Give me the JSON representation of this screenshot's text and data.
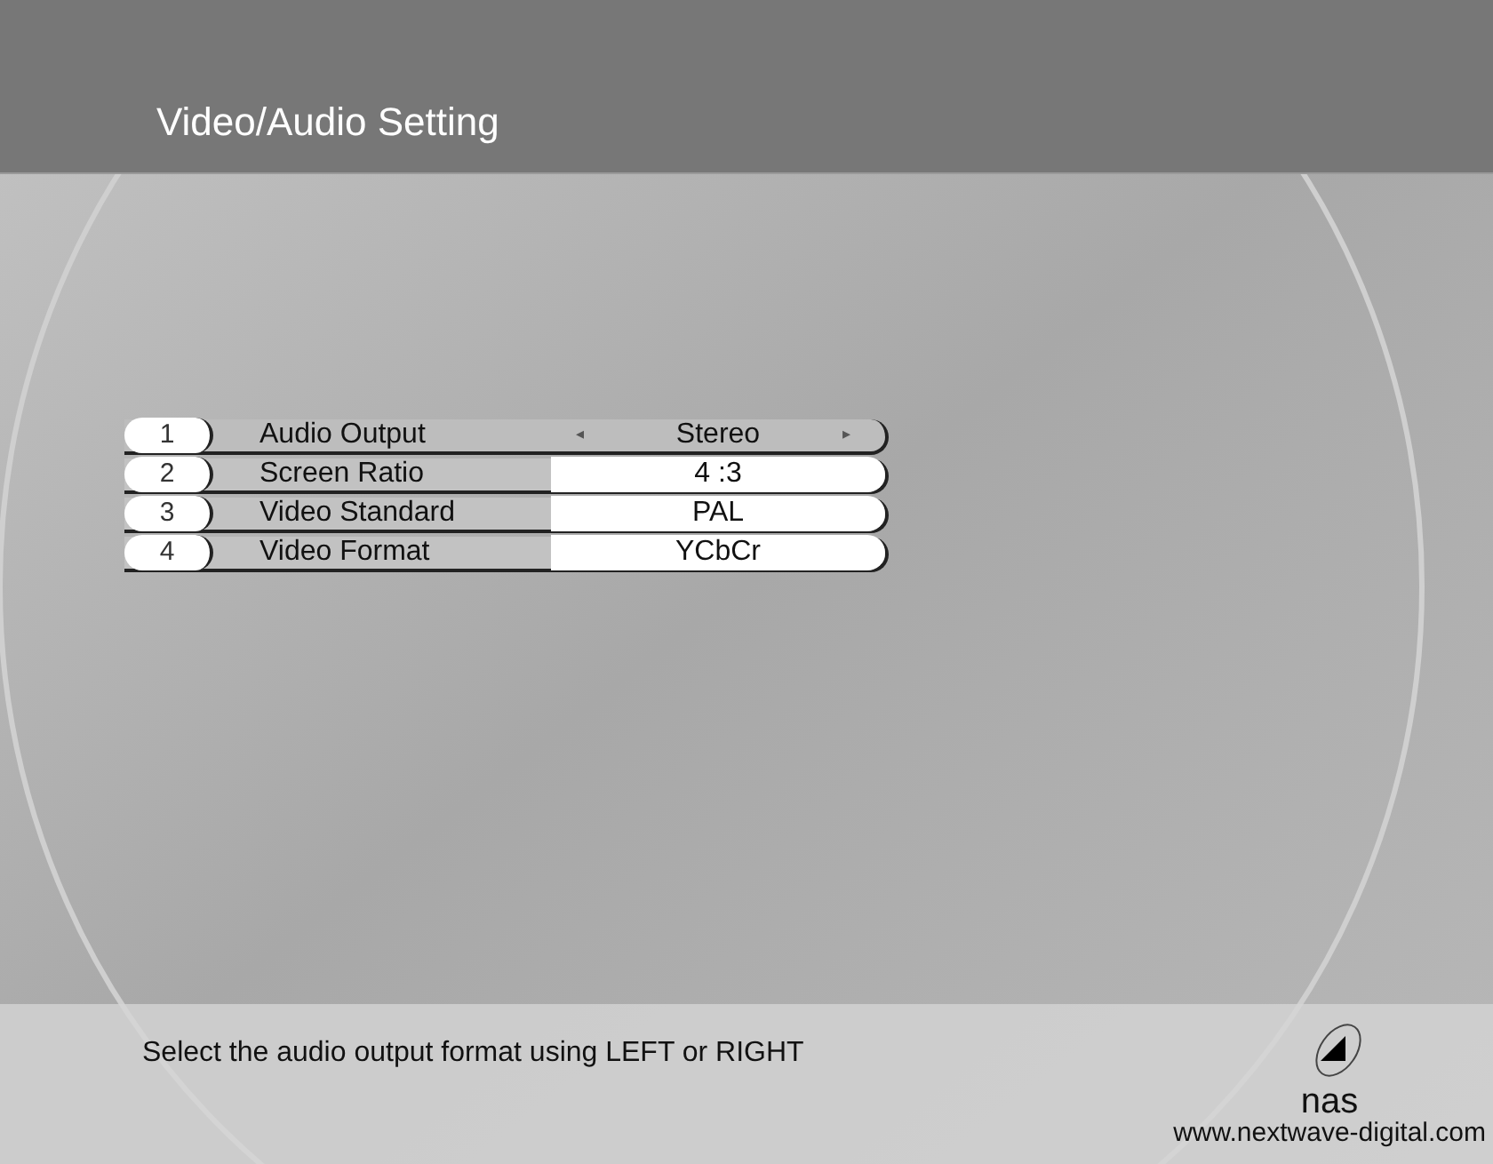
{
  "header": {
    "title": "Video/Audio Setting"
  },
  "settings": [
    {
      "number": "1",
      "label": "Audio Output",
      "value": "Stereo",
      "selected": true,
      "left_arrow": "◂",
      "right_arrow": "▸"
    },
    {
      "number": "2",
      "label": "Screen Ratio",
      "value": "4 :3",
      "selected": false
    },
    {
      "number": "3",
      "label": "Video Standard",
      "value": "PAL",
      "selected": false
    },
    {
      "number": "4",
      "label": "Video Format",
      "value": "YCbCr",
      "selected": false
    }
  ],
  "help_text": "Select the audio output format using LEFT or RIGHT",
  "logo": {
    "name": "nas",
    "url": "www.nextwave-digital.com"
  }
}
